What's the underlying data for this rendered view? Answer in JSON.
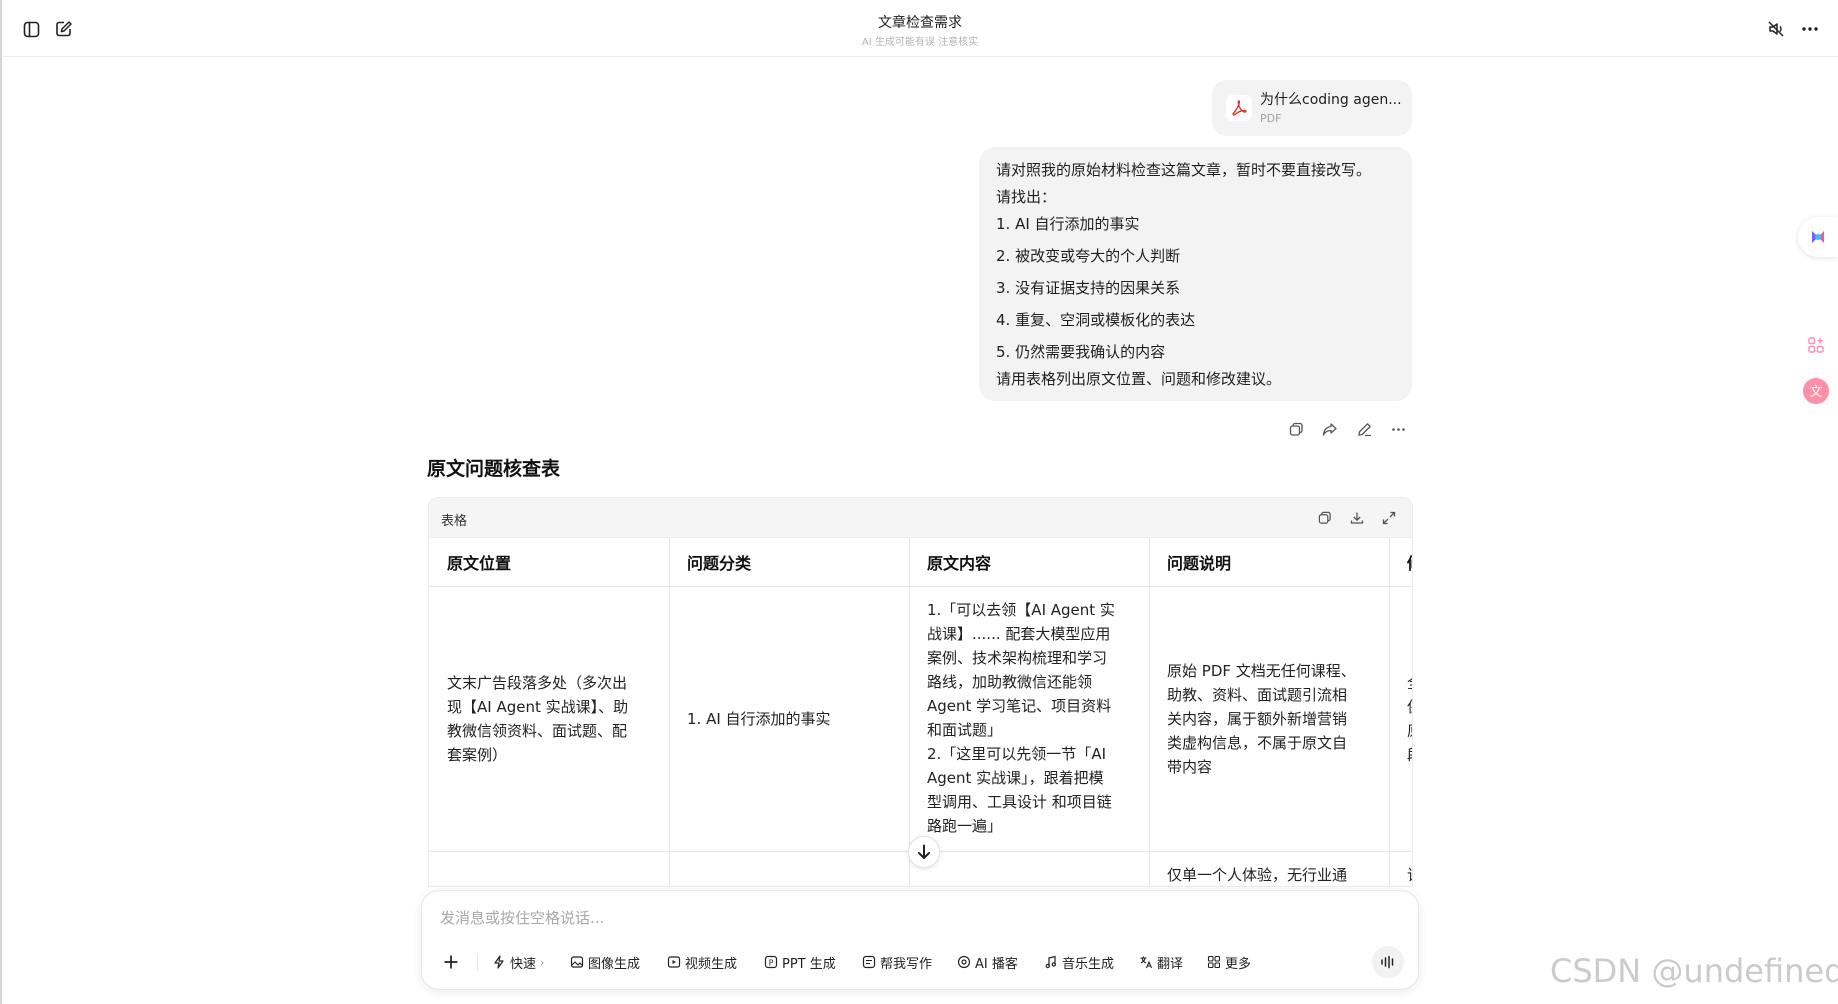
{
  "header": {
    "title": "文章检查需求",
    "subtitle": "AI 生成可能有误 注意核实"
  },
  "attachment": {
    "name": "为什么coding agen...",
    "type": "PDF"
  },
  "user_message": {
    "lines": [
      "请对照我的原始材料检查这篇文章，暂时不要直接改写。",
      "请找出：",
      "1. AI 自行添加的事实",
      "2. 被改变或夸大的个人判断",
      "3. 没有证据支持的因果关系",
      "4. 重复、空洞或模板化的表达",
      "5. 仍然需要我确认的内容",
      "请用表格列出原文位置、问题和修改建议。"
    ]
  },
  "answer": {
    "title": "原文问题核查表",
    "table_label": "表格",
    "columns": [
      "原文位置",
      "问题分类",
      "原文内容",
      "问题说明",
      "修"
    ],
    "row1": {
      "location": [
        "文末广告段落多处（多次出",
        "现【AI Agent 实战课】、助",
        "教微信领资料、面试题、配",
        "套案例）"
      ],
      "category": "1. AI 自行添加的事实",
      "content": [
        "1.「可以去领【AI Agent 实",
        "战课】...... 配套大模型应用",
        "案例、技术架构梳理和学习",
        "路线，加助教微信还能领",
        "Agent 学习笔记、项目资料",
        "和面试题」",
        "2.「这里可以先领一节「AI",
        "Agent 实战课」，跟着把模",
        "型调用、工具设计 和项目链",
        "路跑一遍」"
      ],
      "note": [
        "原始 PDF 文档无任何课程、",
        "助教、资料、面试题引流相",
        "关内容，属于额外新增营销",
        "类虚构信息，不属于原文自",
        "带内容"
      ],
      "fix": [
        "全",
        "保",
        "原",
        "段"
      ]
    },
    "row2": {
      "note": "仅单一个人体验，无行业通",
      "fix": "该"
    }
  },
  "composer": {
    "placeholder": "发消息或按住空格说话...",
    "tools": [
      "快速",
      "图像生成",
      "视频生成",
      "PPT 生成",
      "帮我写作",
      "AI 播客",
      "音乐生成",
      "翻译",
      "更多"
    ]
  },
  "watermark": "CSDN @undefined"
}
